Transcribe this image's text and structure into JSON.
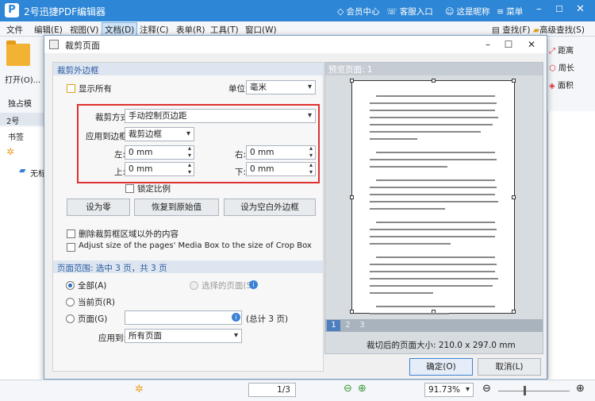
{
  "app": {
    "title": "2号迅捷PDF编辑器",
    "logo_text": "P",
    "top_right": {
      "member": "会员中心",
      "login": "客服入口",
      "nickname": "这是昵称",
      "menu": "菜单"
    },
    "menu": [
      "文件",
      "编辑(E)",
      "视图(V)",
      "文档(D)",
      "注释(C)",
      "表单(R)",
      "工具(T)",
      "窗口(W)"
    ],
    "right_tools": {
      "find": "查找(F)",
      "adv_find": "高级查找(S)",
      "distance": "距离",
      "perimeter": "周长",
      "area": "面积"
    },
    "left": {
      "open": "打开(O)...",
      "standalone": "独占模",
      "tab": "2号",
      "bookmarks": "书签",
      "doc_name": "无标"
    },
    "bottom": {
      "page_value": "1/3",
      "zoom": "91.73%"
    }
  },
  "dialog": {
    "title": "裁剪页面",
    "crop_margins_title": "裁剪外边框",
    "show_all": "显示所有",
    "unit_label": "单位:",
    "unit_value": "毫米",
    "crop_method_label": "裁剪方式",
    "crop_method_value": "手动控制页边距",
    "apply_to_label": "应用到边框",
    "apply_to_value": "裁剪边框",
    "left_label": "左:",
    "left_value": "0 mm",
    "right_label": "右:",
    "right_value": "0 mm",
    "top_label": "上:",
    "top_value": "0 mm",
    "bottom_label": "下:",
    "bottom_value": "0 mm",
    "lock_ratio": "锁定比例",
    "btn_set_zero": "设为零",
    "btn_restore": "恢复到原始值",
    "btn_set_blank": "设为空白外边框",
    "delete_outside": "删除裁剪框区域以外的内容",
    "adjust_media": "Adjust size of the pages' Media Box to the size of Crop Box",
    "page_range_title": "页面范围: 选中 3 页，共 3 页",
    "radio_all": "全部(A)",
    "radio_selected": "选择的页面(S)",
    "radio_current": "当前页(R)",
    "radio_pages": "页面(G)",
    "pages_total": "(总计 3 页)",
    "apply_label": "应用到:",
    "apply_value": "所有页面",
    "preview_label": "预览页面: 1",
    "page_numbers": [
      "1",
      "2",
      "3"
    ],
    "cropped_size": "裁切后的页面大小: 210.0 x 297.0 mm",
    "ok": "确定(O)",
    "cancel": "取消(L)"
  }
}
